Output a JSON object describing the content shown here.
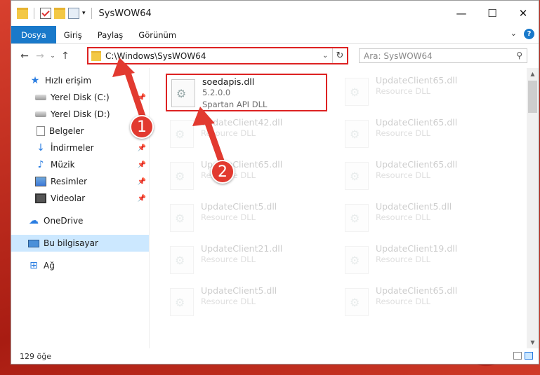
{
  "window": {
    "title": "SysWOW64",
    "minimize": "—",
    "maximize": "☐",
    "close": "✕"
  },
  "ribbon": {
    "tabs": [
      "Dosya",
      "Giriş",
      "Paylaş",
      "Görünüm"
    ],
    "expand": "⌄",
    "help": "?"
  },
  "navigation": {
    "back": "←",
    "forward": "→",
    "recent": "⌄",
    "up": "↑",
    "address": "C:\\Windows\\SysWOW64",
    "dropdown": "⌄",
    "refresh": "↻",
    "search_placeholder": "Ara: SysWOW64",
    "search_icon": "⚲"
  },
  "sidebar": {
    "items": [
      {
        "label": "Hızlı erişim",
        "icon": "star-icon",
        "glyph": "★"
      },
      {
        "label": "Yerel Disk (C:)",
        "icon": "drive-icon",
        "glyph": ""
      },
      {
        "label": "Yerel Disk (D:)",
        "icon": "drive-icon",
        "glyph": ""
      },
      {
        "label": "Belgeler",
        "icon": "document-icon",
        "glyph": ""
      },
      {
        "label": "İndirmeler",
        "icon": "download-icon",
        "glyph": "↓"
      },
      {
        "label": "Müzik",
        "icon": "music-icon",
        "glyph": "♪"
      },
      {
        "label": "Resimler",
        "icon": "picture-icon",
        "glyph": ""
      },
      {
        "label": "Videolar",
        "icon": "video-icon",
        "glyph": ""
      },
      {
        "label": "OneDrive",
        "icon": "cloud-icon",
        "glyph": "☁"
      },
      {
        "label": "Bu bilgisayar",
        "icon": "computer-icon",
        "glyph": ""
      },
      {
        "label": "Ağ",
        "icon": "network-icon",
        "glyph": "⊞"
      }
    ],
    "pin": "📌"
  },
  "files": [
    {
      "name": "soedapis.dll",
      "line2": "5.2.0.0",
      "line3": "Spartan API DLL"
    },
    {
      "name": "UpdateClient65.dll",
      "line2": "Resource DLL"
    },
    {
      "name": "UpdateClient42.dll",
      "line2": "Resource DLL"
    },
    {
      "name": "UpdateClient65.dll",
      "line2": "Resource DLL"
    },
    {
      "name": "UpdateClient65.dll",
      "line2": "Resource DLL"
    },
    {
      "name": "UpdateClient65.dll",
      "line2": "Resource DLL"
    },
    {
      "name": "UpdateClient5.dll",
      "line2": "Resource DLL"
    },
    {
      "name": "UpdateClient5.dll",
      "line2": "Resource DLL"
    },
    {
      "name": "UpdateClient21.dll",
      "line2": "Resource DLL"
    },
    {
      "name": "UpdateClient19.dll",
      "line2": "Resource DLL"
    },
    {
      "name": "UpdateClient5.dll",
      "line2": "Resource DLL"
    },
    {
      "name": "UpdateClient65.dll",
      "line2": "Resource DLL"
    }
  ],
  "status": {
    "count": "129 öğe"
  },
  "annotations": {
    "step1": "1",
    "step2": "2",
    "color": "#e23a30"
  }
}
